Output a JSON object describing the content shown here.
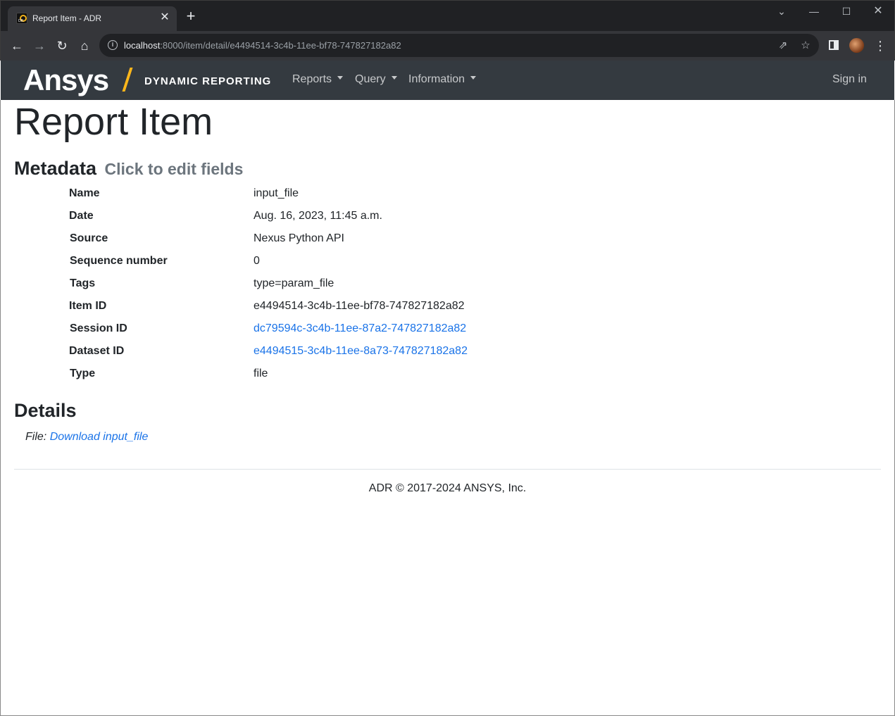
{
  "browser": {
    "tab_title": "Report Item - ADR",
    "tab_close": "✕",
    "new_tab": "+",
    "url_host": "localhost",
    "url_rest": ":8000/item/detail/e4494514-3c4b-11ee-bf78-747827182a82",
    "icons": [
      "back-icon",
      "forward-icon",
      "reload-icon",
      "home-icon",
      "info-icon",
      "share-icon",
      "star-icon",
      "side-panel-icon",
      "profile-avatar",
      "menu-icon"
    ]
  },
  "navbar": {
    "logo_text": "Ansys",
    "logo_subtitle": "DYNAMIC REPORTING",
    "menu": [
      {
        "label": "Reports"
      },
      {
        "label": "Query"
      },
      {
        "label": "Information"
      }
    ],
    "sign_in": "Sign in",
    "colors": {
      "background": "#343a40",
      "accent": "#ffb71b"
    }
  },
  "page": {
    "title": "Report Item",
    "metadata_heading": "Metadata",
    "metadata_hint": "Click to edit fields",
    "metadata": [
      {
        "key": "Name",
        "value": "input_file",
        "link": false
      },
      {
        "key": "Date",
        "value": "Aug. 16, 2023, 11:45 a.m.",
        "link": false
      },
      {
        "key": "Source",
        "value": "Nexus Python API",
        "link": false
      },
      {
        "key": "Sequence number",
        "value": "0",
        "link": false
      },
      {
        "key": "Tags",
        "value": "type=param_file",
        "link": false
      },
      {
        "key": "Item ID",
        "value": "e4494514-3c4b-11ee-bf78-747827182a82",
        "link": false
      },
      {
        "key": "Session ID",
        "value": "dc79594c-3c4b-11ee-87a2-747827182a82",
        "link": true
      },
      {
        "key": "Dataset ID",
        "value": "e4494515-3c4b-11ee-8a73-747827182a82",
        "link": true
      },
      {
        "key": "Type",
        "value": "file",
        "link": false
      }
    ],
    "details_heading": "Details",
    "file_label": "File:",
    "file_link": "Download input_file",
    "link_color": "#1a73e8"
  },
  "footer": {
    "text": "ADR © 2017-2024 ANSYS, Inc."
  }
}
